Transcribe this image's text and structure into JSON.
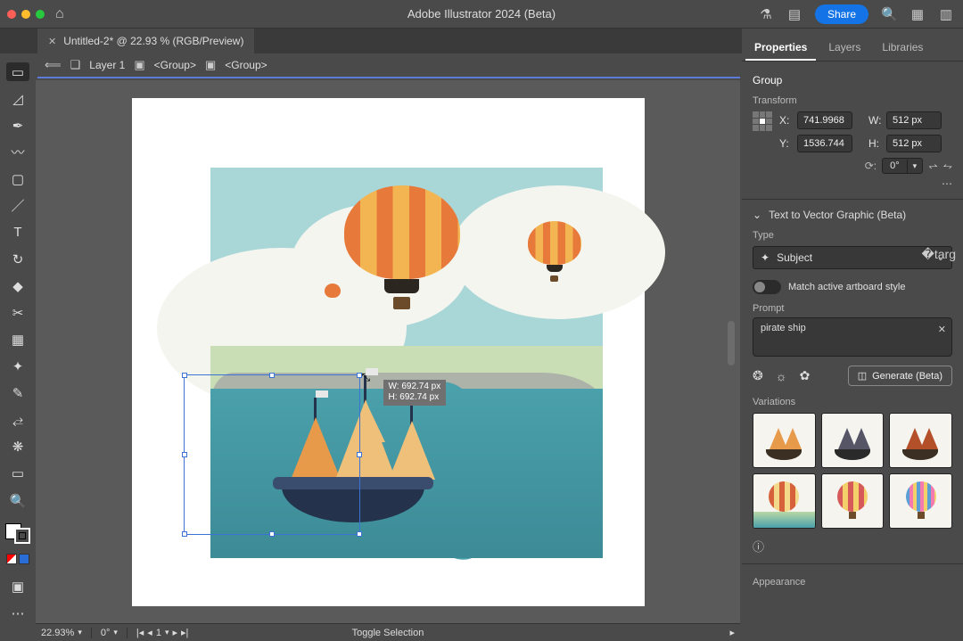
{
  "app_title": "Adobe Illustrator 2024 (Beta)",
  "share_label": "Share",
  "tab": {
    "label": "Untitled-2* @ 22.93 % (RGB/Preview)"
  },
  "breadcrumb": {
    "layer": "Layer 1",
    "g1": "<Group>",
    "g2": "<Group>"
  },
  "measure": {
    "w": "W: 692.74 px",
    "h": "H: 692.74 px"
  },
  "panel_tabs": {
    "properties": "Properties",
    "layers": "Layers",
    "libraries": "Libraries"
  },
  "selection_type": "Group",
  "transform": {
    "heading": "Transform",
    "x_label": "X:",
    "x": "741.9968",
    "y_label": "Y:",
    "y": "1536.744",
    "w_label": "W:",
    "w": "512 px",
    "h_label": "H:",
    "h": "512 px",
    "rotate": "0°"
  },
  "t2v": {
    "heading": "Text to Vector Graphic (Beta)",
    "type_label": "Type",
    "type_value": "Subject",
    "match_label": "Match active artboard style",
    "prompt_label": "Prompt",
    "prompt_value": "pirate ship",
    "generate_label": "Generate (Beta)",
    "variations_label": "Variations"
  },
  "appearance_label": "Appearance",
  "status": {
    "zoom": "22.93%",
    "rotate": "0°",
    "artboard": "1",
    "mode": "Toggle Selection"
  }
}
